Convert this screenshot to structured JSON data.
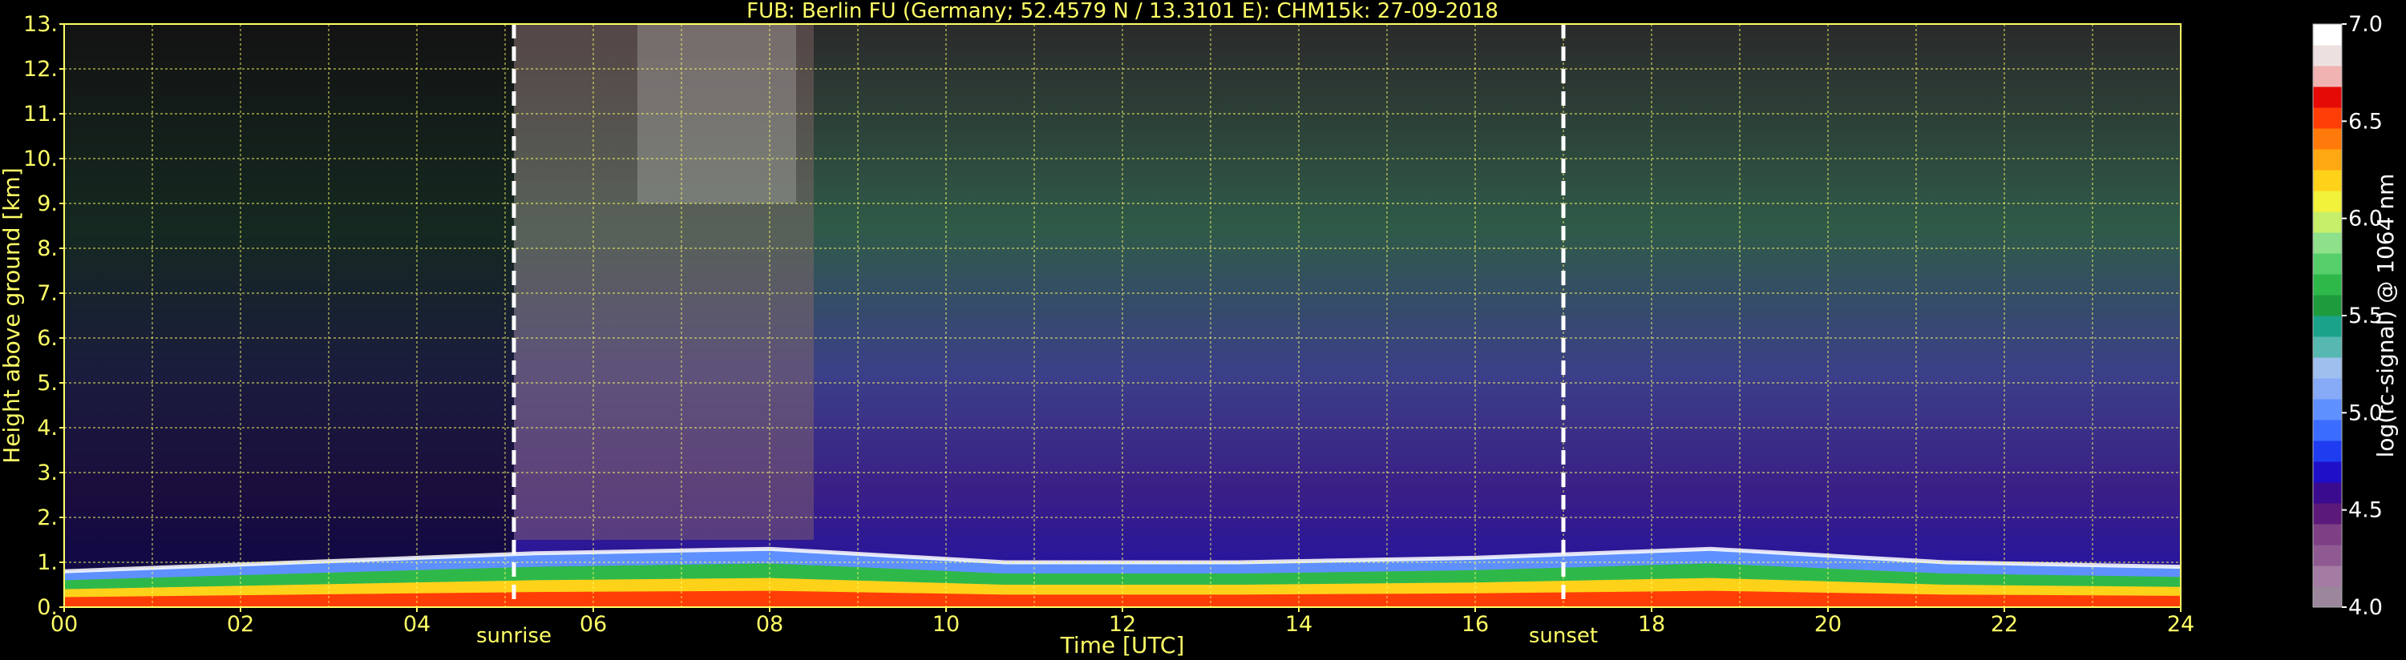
{
  "chart_data": {
    "type": "heatmap",
    "title": "FUB: Berlin FU (Germany; 52.4579 N / 13.3101 E):    CHM15k: 27-09-2018",
    "xlabel": "Time [UTC]",
    "ylabel": "Height above ground [km]",
    "xlim": [
      0,
      24
    ],
    "ylim": [
      0,
      13
    ],
    "x_ticks": [
      "00",
      "02",
      "04",
      "06",
      "08",
      "10",
      "12",
      "14",
      "16",
      "18",
      "20",
      "22",
      "24"
    ],
    "y_ticks": [
      "0.",
      "1.",
      "2.",
      "3.",
      "4.",
      "5.",
      "6.",
      "7.",
      "8.",
      "9.",
      "10.",
      "11.",
      "12.",
      "13."
    ],
    "grid": true,
    "events": [
      {
        "label": "sunrise",
        "time": 5.1
      },
      {
        "label": "sunset",
        "time": 17.0
      }
    ],
    "colorbar": {
      "label": "log(rc-signal) @ 1064 nm",
      "range": [
        4.0,
        7.0
      ],
      "ticks": [
        "4.0",
        "4.5",
        "5.0",
        "5.5",
        "6.0",
        "6.5",
        "7.0"
      ],
      "colors": [
        "#9b869c",
        "#a47ba3",
        "#8f5a91",
        "#7e3f84",
        "#5b1a7a",
        "#3a0a8f",
        "#1e10c8",
        "#1f3cf0",
        "#3a6cff",
        "#5f90ff",
        "#86aaf6",
        "#9fc0ee",
        "#56b8b0",
        "#1aa38a",
        "#1e9b3c",
        "#2fb84a",
        "#56cf6a",
        "#8fe08a",
        "#c8ef6a",
        "#f2f23a",
        "#ffd21a",
        "#ffa812",
        "#ff7a0a",
        "#ff3d06",
        "#e60a06",
        "#f0b3b1",
        "#ede0e0",
        "#ffffff"
      ]
    },
    "layers": [
      {
        "name": "background noise",
        "top_km": 13.0
      },
      {
        "name": "aerosol layer",
        "top_km": [
          0.8,
          1.0,
          1.2,
          1.3,
          1.0,
          1.0,
          1.1,
          1.3,
          1.0,
          0.9
        ]
      }
    ]
  }
}
